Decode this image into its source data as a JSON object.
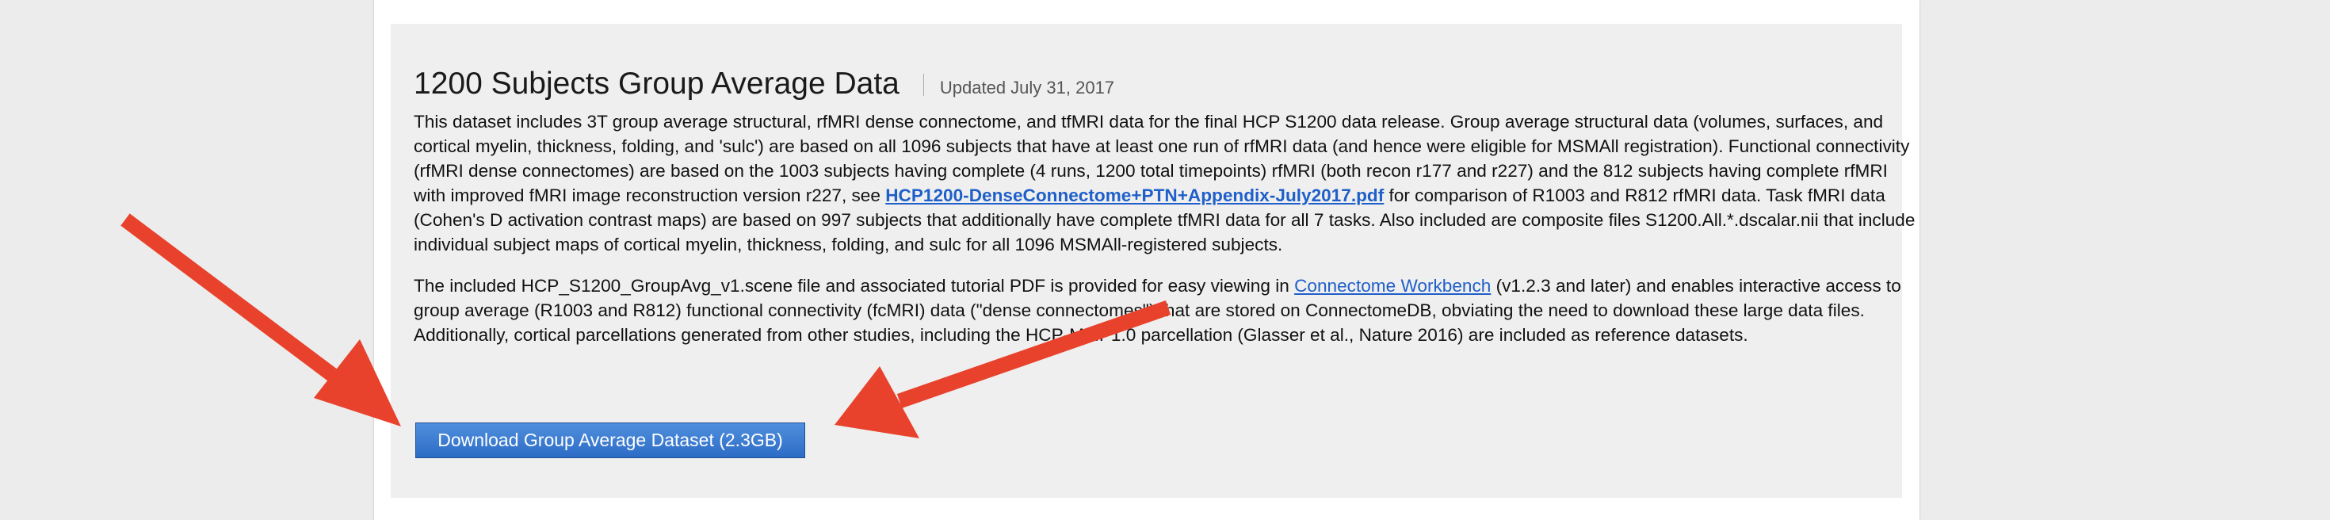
{
  "dataset": {
    "title": "1200 Subjects Group Average Data",
    "updated": "Updated July 31, 2017",
    "para1_a": "This dataset includes 3T group average structural, rfMRI dense connectome, and tfMRI data for the final HCP S1200 data release. Group average structural data (volumes, surfaces, and cortical myelin, thickness, folding, and 'sulc') are based on all 1096 subjects that have at least one run of rfMRI data (and hence were eligible for MSMAll registration). Functional connectivity (rfMRI dense connectomes) are based on the 1003 subjects having complete (4 runs, 1200 total timepoints) rfMRI (both recon r177 and r227) and the 812 subjects having complete rfMRI with improved fMRI image reconstruction version r227, see ",
    "para1_link": "HCP1200-DenseConnectome+PTN+Appendix-July2017.pdf",
    "para1_b": " for comparison of R1003 and R812 rfMRI data. Task fMRI data (Cohen's D activation contrast maps) are based on 997 subjects that additionally have complete tfMRI data for all 7 tasks. Also included are composite files S1200.All.*.dscalar.nii that include individual subject maps of cortical myelin, thickness, folding, and sulc for all 1096 MSMAll-registered subjects.",
    "para2_a": "The included HCP_S1200_GroupAvg_v1.scene file and associated tutorial PDF is provided for easy viewing in ",
    "para2_link": "Connectome Workbench",
    "para2_b": " (v1.2.3 and later) and enables interactive access to group average (R1003 and R812) functional connectivity (fcMRI) data (\"dense connectomes\") that are stored on ConnectomeDB, obviating the need to download these large data files. Additionally, cortical parcellations generated from other studies, including the HCP-MMP1.0 parcellation (Glasser et al., Nature 2016) are included as reference datasets.",
    "download_label": "Download Group Average Dataset (2.3GB)"
  },
  "colors": {
    "arrow": "#e8412c",
    "link": "#1f5fc9",
    "button": "#2d6cc6",
    "panel": "#efefef",
    "background": "#ececec"
  },
  "annotations": {
    "arrow_count": 2,
    "arrow_target": "download-button"
  }
}
